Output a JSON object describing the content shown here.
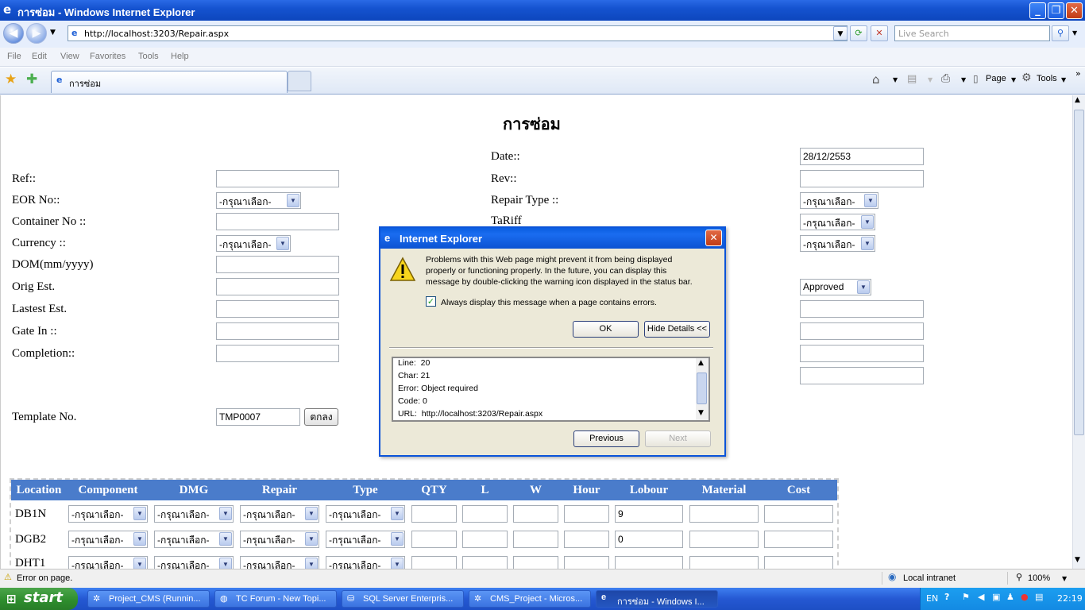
{
  "window": {
    "title": "การซ่อม - Windows Internet Explorer",
    "address": "http://localhost:3203/Repair.aspx",
    "search_placeholder": "Live Search",
    "tab_label": "การซ่อม"
  },
  "menu": [
    "File",
    "Edit",
    "View",
    "Favorites",
    "Tools",
    "Help"
  ],
  "command_bar": {
    "page": "Page",
    "tools": "Tools"
  },
  "page": {
    "heading": "การซ่อม",
    "left_labels": [
      "Ref::",
      "EOR No::",
      "Container No ::",
      "Currency ::",
      "DOM(mm/yyyy)",
      "Orig Est.",
      "Lastest Est.",
      "Gate In ::",
      "Completion::"
    ],
    "right_labels": [
      "Date::",
      "Rev::",
      "Repair Type ::",
      "TaRiff"
    ],
    "date_value": "28/12/2553",
    "select_default": "-กรุณาเลือก-",
    "status_select": "Approved",
    "template_label": "Template No.",
    "template_value": "TMP0007",
    "ok_button": "ตกลง",
    "table": {
      "headers": [
        "Location",
        "Component",
        "DMG",
        "Repair",
        "Type",
        "QTY",
        "L",
        "W",
        "Hour",
        "Lobour",
        "Material",
        "Cost"
      ],
      "rows": [
        {
          "location": "DB1N",
          "lobour": "9"
        },
        {
          "location": "DGB2",
          "lobour": "0"
        },
        {
          "location": "DHT1",
          "lobour": ""
        }
      ]
    }
  },
  "dialog": {
    "title": "Internet Explorer",
    "message": "Problems with this Web page might prevent it from being displayed properly or functioning properly. In the future, you can display this message by double-clicking the warning icon displayed in the status bar.",
    "message_lines": [
      "Problems with this Web page might prevent it from being displayed",
      "properly or functioning properly. In the future, you can display this",
      "message by double-clicking the warning icon displayed in the status bar."
    ],
    "checkbox_label": "Always display this message when a page contains errors.",
    "checkbox_checked": true,
    "ok": "OK",
    "hide_details": "Hide Details <<",
    "details": {
      "line_label": "Line:",
      "line": "20",
      "char_label": "Char:",
      "char": "21",
      "error_label": "Error:",
      "error": "Object required",
      "code_label": "Code:",
      "code": "0",
      "url_label": "URL:",
      "url": "http://localhost:3203/Repair.aspx"
    },
    "previous": "Previous",
    "next": "Next"
  },
  "statusbar": {
    "message": "Error on page.",
    "zone": "Local intranet",
    "zoom": "100%"
  },
  "taskbar": {
    "start": "start",
    "tasks": [
      "Project_CMS (Runnin...",
      "TC Forum - New Topi...",
      "SQL Server Enterpris...",
      "CMS_Project - Micros...",
      "การซ่อม - Windows I..."
    ],
    "language": "EN",
    "clock": "22:19"
  }
}
